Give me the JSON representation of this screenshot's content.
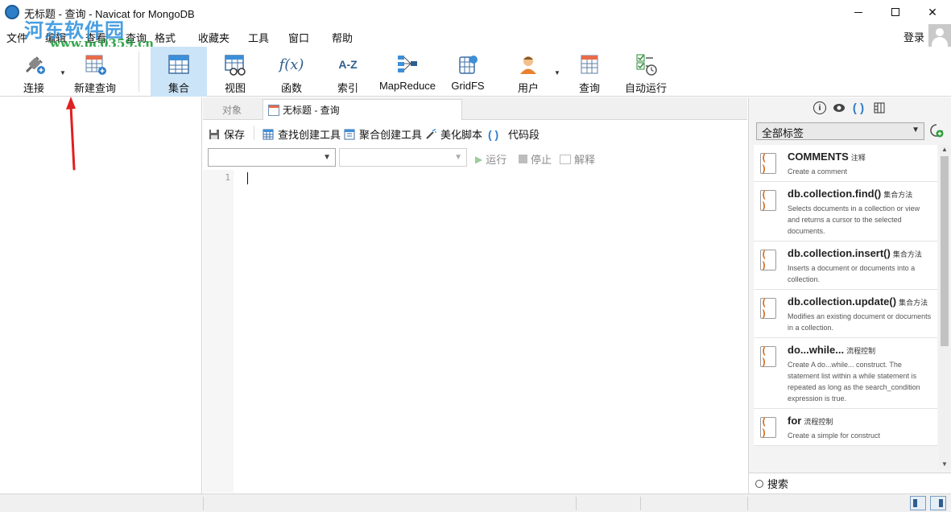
{
  "window": {
    "title": "无标题 - 查询 - Navicat for MongoDB"
  },
  "watermark": {
    "text": "河东软件园",
    "url": "www.pc0359.cn"
  },
  "menu": {
    "items": [
      "文件",
      "编辑",
      "查看",
      "查询",
      "格式",
      "收藏夹",
      "工具",
      "窗口",
      "帮助"
    ],
    "login": "登录"
  },
  "toolbar": {
    "connect": "连接",
    "new_query": "新建查询",
    "collection": "集合",
    "view": "视图",
    "function": "函数",
    "function_icon": "f(x)",
    "index": "索引",
    "index_icon": "A-Z",
    "mapreduce": "MapReduce",
    "gridfs": "GridFS",
    "user": "用户",
    "query": "查询",
    "auto_run": "自动运行",
    "active": "集合"
  },
  "tabs": {
    "objects": "对象",
    "query": "无标题 - 查询"
  },
  "query_toolbar": {
    "save": "保存",
    "find_builder": "查找创建工具",
    "aggregate_builder": "聚合创建工具",
    "beautify": "美化脚本",
    "snippet": "代码段"
  },
  "run_bar": {
    "run": "运行",
    "stop": "停止",
    "explain": "解释"
  },
  "editor": {
    "line_numbers": [
      "1"
    ]
  },
  "right_panel": {
    "tag_filter": "全部标签",
    "search_label": "搜索",
    "snippets": [
      {
        "title": "COMMENTS",
        "category": "注释",
        "desc": "Create a comment"
      },
      {
        "title": "db.collection.find()",
        "category": "集合方法",
        "desc": "Selects documents in a collection or view and returns a cursor to the selected documents."
      },
      {
        "title": "db.collection.insert()",
        "category": "集合方法",
        "desc": "Inserts a document or documents into a collection."
      },
      {
        "title": "db.collection.update()",
        "category": "集合方法",
        "desc": "Modifies an existing document or documents in a collection."
      },
      {
        "title": "do...while...",
        "category": "流程控制",
        "desc": "Create A do...while... construct. The statement list within a while statement is repeated as long as the search_condition expression is true."
      },
      {
        "title": "for",
        "category": "流程控制",
        "desc": "Create a simple for construct"
      }
    ]
  },
  "colors": {
    "accent": "#2f7ec8",
    "active_tool_bg": "#cce4f7",
    "annotation_arrow": "#e02020",
    "snippet_icon": "#d2691e"
  }
}
